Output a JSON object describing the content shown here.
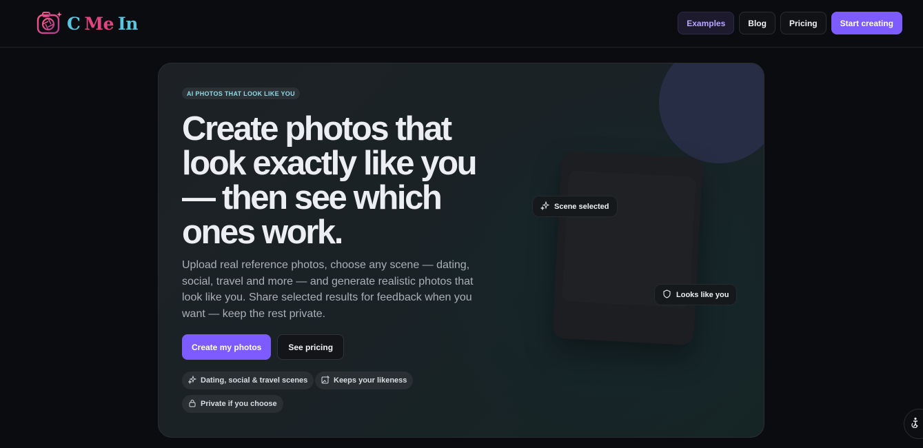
{
  "brand": {
    "parts": [
      "C",
      "Me",
      "In"
    ],
    "colors": {
      "cyan": "#58c6e0",
      "pink": "#e0457f"
    }
  },
  "nav": {
    "examples": "Examples",
    "blog": "Blog",
    "pricing": "Pricing",
    "start": "Start creating"
  },
  "hero": {
    "badge": "AI PHOTOS THAT LOOK LIKE YOU",
    "headline": "Create photos that look exactly like you — then see which ones work.",
    "subtext": "Upload real reference photos, choose any scene — dating, social, travel and more — and generate realistic photos that look like you. Share selected results for feedback when you want — keep the rest private.",
    "cta_primary": "Create my photos",
    "cta_secondary": "See pricing",
    "features": [
      {
        "label": "Dating, social & travel scenes",
        "icon": "sparkle-icon"
      },
      {
        "label": "Keeps your likeness",
        "icon": "image-edit-icon"
      },
      {
        "label": "Private if you choose",
        "icon": "lock-icon"
      }
    ]
  },
  "preview": {
    "scene_chip": "Scene selected",
    "likeness_chip": "Looks like you"
  },
  "colors": {
    "accent": "#7c5cff",
    "background": "#0b0c0f"
  }
}
